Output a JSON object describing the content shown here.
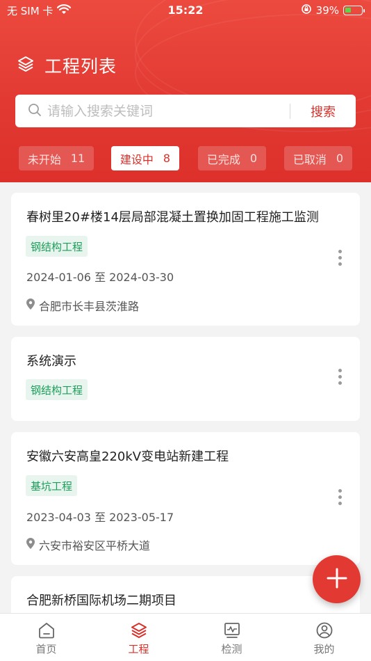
{
  "status_bar": {
    "carrier": "无 SIM 卡",
    "time": "15:22",
    "battery_percent": "39%",
    "battery_level": 0.39
  },
  "header": {
    "title": "工程列表"
  },
  "search": {
    "placeholder": "请输入搜索关键词",
    "button_label": "搜索"
  },
  "tabs": [
    {
      "label": "未开始",
      "count": "11"
    },
    {
      "label": "建设中",
      "count": "8"
    },
    {
      "label": "已完成",
      "count": "0"
    },
    {
      "label": "已取消",
      "count": "0"
    }
  ],
  "projects": [
    {
      "title": "春树里20#楼14层局部混凝土置换加固工程施工监测",
      "tag": "钢结构工程",
      "dates": "2024-01-06 至 2024-03-30",
      "location": "合肥市长丰县茨淮路"
    },
    {
      "title": "系统演示",
      "tag": "钢结构工程"
    },
    {
      "title": "安徽六安高皇220kV变电站新建工程",
      "tag": "基坑工程",
      "dates": "2023-04-03 至 2023-05-17",
      "location": "六安市裕安区平桥大道"
    },
    {
      "title": "合肥新桥国际机场二期项目"
    }
  ],
  "bottom_nav": [
    {
      "label": "首页",
      "icon": "home-icon"
    },
    {
      "label": "工程",
      "icon": "layers-icon"
    },
    {
      "label": "检测",
      "icon": "monitor-icon"
    },
    {
      "label": "我的",
      "icon": "user-icon"
    }
  ],
  "colors": {
    "primary": "#e23a33",
    "tag_green": "#1c9e5a",
    "tag_bg": "#e8f5ee"
  }
}
